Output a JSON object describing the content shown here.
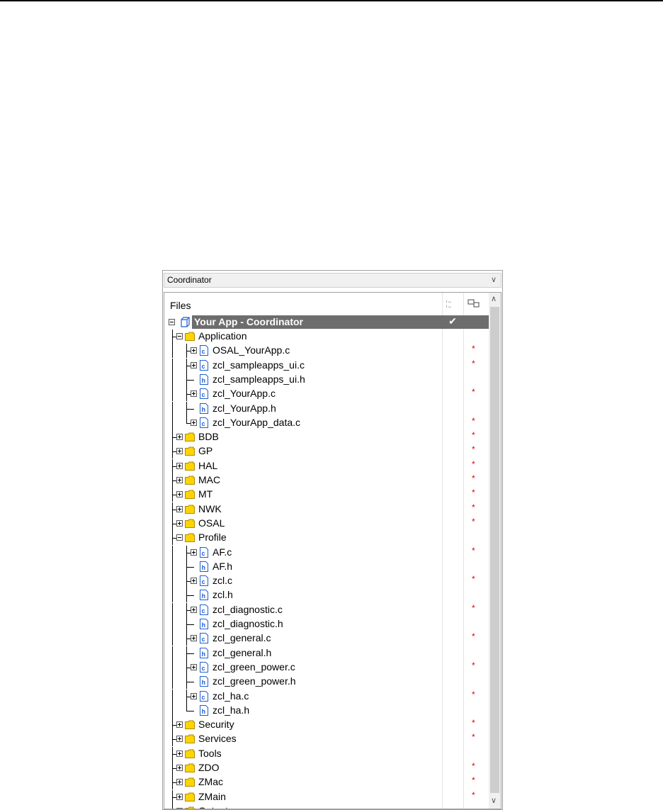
{
  "config_selector": {
    "value": "Coordinator"
  },
  "files_header": {
    "label": "Files",
    "col1_icon": "compile-check-icon",
    "col2_icon": "output-icon"
  },
  "project": {
    "name": "Your App - Coordinator",
    "check": "✔",
    "icon": "workspace-icon"
  },
  "colors": {
    "selected_bg": "#6d6d6d",
    "folder": "#ffd400",
    "file_icon": "#1f5fcf",
    "star": "#e00000"
  },
  "tree": [
    {
      "label": "Application",
      "type": "folder",
      "level": 1,
      "expander": "minus",
      "star": false,
      "last": false
    },
    {
      "label": "OSAL_YourApp.c",
      "type": "c",
      "level": 2,
      "expander": "plus",
      "star": true,
      "last": false
    },
    {
      "label": "zcl_sampleapps_ui.c",
      "type": "c",
      "level": 2,
      "expander": "plus",
      "star": true,
      "last": false
    },
    {
      "label": "zcl_sampleapps_ui.h",
      "type": "h",
      "level": 2,
      "expander": "none",
      "star": false,
      "last": false
    },
    {
      "label": "zcl_YourApp.c",
      "type": "c",
      "level": 2,
      "expander": "plus",
      "star": true,
      "last": false
    },
    {
      "label": "zcl_YourApp.h",
      "type": "h",
      "level": 2,
      "expander": "none",
      "star": false,
      "last": false
    },
    {
      "label": "zcl_YourApp_data.c",
      "type": "c",
      "level": 2,
      "expander": "plus",
      "star": true,
      "last": true
    },
    {
      "label": "BDB",
      "type": "folder",
      "level": 1,
      "expander": "plus",
      "star": true,
      "last": false
    },
    {
      "label": "GP",
      "type": "folder",
      "level": 1,
      "expander": "plus",
      "star": true,
      "last": false
    },
    {
      "label": "HAL",
      "type": "folder",
      "level": 1,
      "expander": "plus",
      "star": true,
      "last": false
    },
    {
      "label": "MAC",
      "type": "folder",
      "level": 1,
      "expander": "plus",
      "star": true,
      "last": false
    },
    {
      "label": "MT",
      "type": "folder",
      "level": 1,
      "expander": "plus",
      "star": true,
      "last": false
    },
    {
      "label": "NWK",
      "type": "folder",
      "level": 1,
      "expander": "plus",
      "star": true,
      "last": false
    },
    {
      "label": "OSAL",
      "type": "folder",
      "level": 1,
      "expander": "plus",
      "star": true,
      "last": false
    },
    {
      "label": "Profile",
      "type": "folder",
      "level": 1,
      "expander": "minus",
      "star": false,
      "last": false
    },
    {
      "label": "AF.c",
      "type": "c",
      "level": 2,
      "expander": "plus",
      "star": true,
      "last": false
    },
    {
      "label": "AF.h",
      "type": "h",
      "level": 2,
      "expander": "none",
      "star": false,
      "last": false
    },
    {
      "label": "zcl.c",
      "type": "c",
      "level": 2,
      "expander": "plus",
      "star": true,
      "last": false
    },
    {
      "label": "zcl.h",
      "type": "h",
      "level": 2,
      "expander": "none",
      "star": false,
      "last": false
    },
    {
      "label": "zcl_diagnostic.c",
      "type": "c",
      "level": 2,
      "expander": "plus",
      "star": true,
      "last": false
    },
    {
      "label": "zcl_diagnostic.h",
      "type": "h",
      "level": 2,
      "expander": "none",
      "star": false,
      "last": false
    },
    {
      "label": "zcl_general.c",
      "type": "c",
      "level": 2,
      "expander": "plus",
      "star": true,
      "last": false
    },
    {
      "label": "zcl_general.h",
      "type": "h",
      "level": 2,
      "expander": "none",
      "star": false,
      "last": false
    },
    {
      "label": "zcl_green_power.c",
      "type": "c",
      "level": 2,
      "expander": "plus",
      "star": true,
      "last": false
    },
    {
      "label": "zcl_green_power.h",
      "type": "h",
      "level": 2,
      "expander": "none",
      "star": false,
      "last": false
    },
    {
      "label": "zcl_ha.c",
      "type": "c",
      "level": 2,
      "expander": "plus",
      "star": true,
      "last": false
    },
    {
      "label": "zcl_ha.h",
      "type": "h",
      "level": 2,
      "expander": "none",
      "star": false,
      "last": true
    },
    {
      "label": "Security",
      "type": "folder",
      "level": 1,
      "expander": "plus",
      "star": true,
      "last": false
    },
    {
      "label": "Services",
      "type": "folder",
      "level": 1,
      "expander": "plus",
      "star": true,
      "last": false
    },
    {
      "label": "Tools",
      "type": "folder",
      "level": 1,
      "expander": "plus",
      "star": false,
      "last": false
    },
    {
      "label": "ZDO",
      "type": "folder",
      "level": 1,
      "expander": "plus",
      "star": true,
      "last": false
    },
    {
      "label": "ZMac",
      "type": "folder",
      "level": 1,
      "expander": "plus",
      "star": true,
      "last": false
    },
    {
      "label": "ZMain",
      "type": "folder",
      "level": 1,
      "expander": "plus",
      "star": true,
      "last": false
    },
    {
      "label": "Output",
      "type": "folder",
      "level": 1,
      "expander": "plus",
      "star": false,
      "last": false
    }
  ]
}
